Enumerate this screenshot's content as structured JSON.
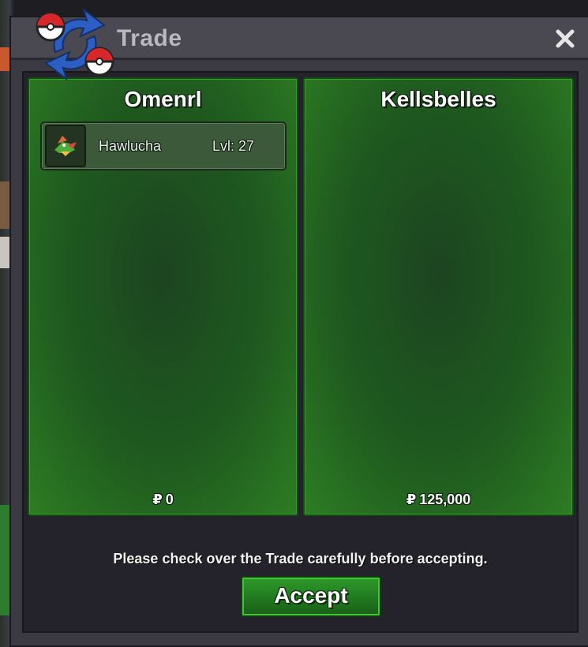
{
  "window": {
    "title": "Trade",
    "close_icon": "close-icon"
  },
  "left_panel": {
    "player": "Omenrl",
    "money_symbol": "₽",
    "money": "0",
    "items": [
      {
        "name": "Hawlucha",
        "level": "Lvl: 27",
        "icon": "hawlucha-sprite-icon"
      }
    ]
  },
  "right_panel": {
    "player": "Kellsbelles",
    "money_symbol": "₽",
    "money": "125,000",
    "items": []
  },
  "footer": {
    "notice": "Please check over the Trade carefully before accepting.",
    "accept_label": "Accept"
  },
  "colors": {
    "panel_green": "#1f5a1f",
    "accept_green": "#21791f",
    "window_gray": "#3b3a43"
  }
}
